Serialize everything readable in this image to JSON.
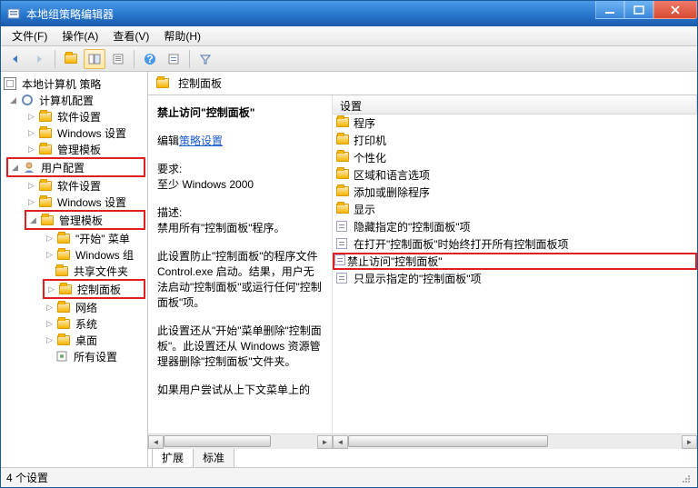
{
  "window": {
    "title": "本地组策略编辑器"
  },
  "menu": {
    "file": "文件(F)",
    "action": "操作(A)",
    "view": "查看(V)",
    "help": "帮助(H)"
  },
  "tree": {
    "root": "本地计算机 策略",
    "computer_cfg": "计算机配置",
    "cc_soft": "软件设置",
    "cc_win": "Windows 设置",
    "cc_admin": "管理模板",
    "user_cfg": "用户配置",
    "uc_soft": "软件设置",
    "uc_win": "Windows 设置",
    "uc_admin": "管理模板",
    "start_menu": "\"开始\" 菜单",
    "win_comp": "Windows 组",
    "shared": "共享文件夹",
    "control_panel": "控制面板",
    "network": "网络",
    "system": "系统",
    "desktop": "桌面",
    "all_settings": "所有设置"
  },
  "right_header": "控制面板",
  "desc": {
    "title": "禁止访问\"控制面板\"",
    "edit_label": "编辑",
    "policy_link": "策略设置",
    "req_label": "要求:",
    "req_val": "至少 Windows 2000",
    "desc_label": "描述:",
    "para1": "禁用所有\"控制面板\"程序。",
    "para2": "此设置防止\"控制面板\"的程序文件 Control.exe 启动。结果，用户无法启动\"控制面板\"或运行任何\"控制面板\"项。",
    "para3": "此设置还从\"开始\"菜单删除\"控制面板\"。此设置还从 Windows 资源管理器删除\"控制面板\"文件夹。",
    "para4": "如果用户尝试从上下文菜单上的"
  },
  "list": {
    "col_setting": "设置",
    "items": [
      "程序",
      "打印机",
      "个性化",
      "区域和语言选项",
      "添加或删除程序",
      "显示",
      "隐藏指定的\"控制面板\"项",
      "在打开\"控制面板\"时始终打开所有控制面板项",
      "禁止访问\"控制面板\"",
      "只显示指定的\"控制面板\"项"
    ]
  },
  "tabs": {
    "extended": "扩展",
    "standard": "标准"
  },
  "status": "4 个设置"
}
